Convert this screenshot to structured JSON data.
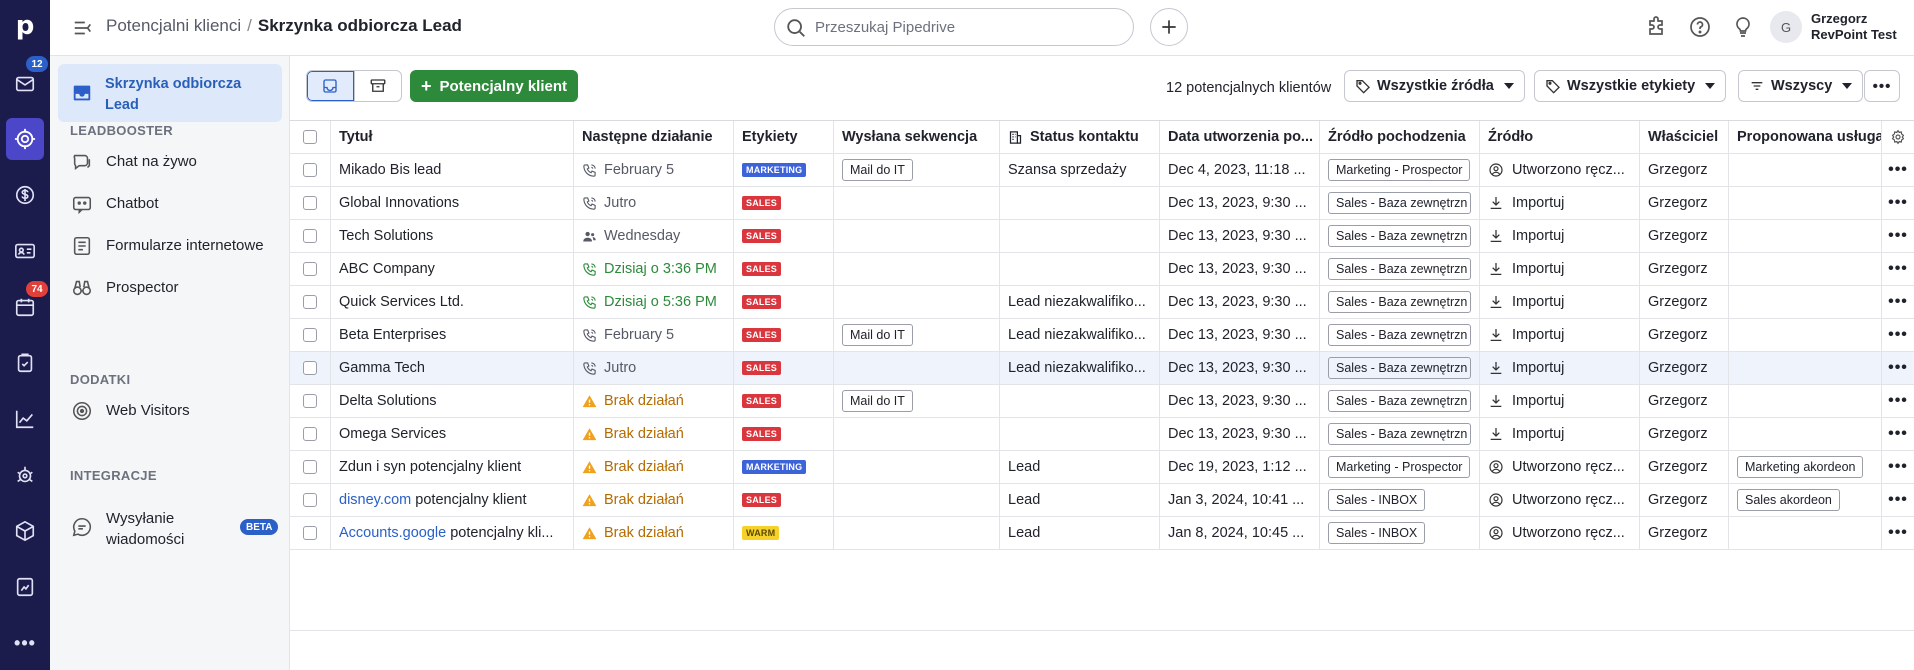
{
  "rail": {
    "logo": "p",
    "badges": {
      "mail": "12",
      "calendar": "74"
    },
    "badge_colors": {
      "mail": "#2a60c8",
      "calendar": "#e0403a"
    },
    "items": [
      "mail-icon",
      "target-icon",
      "dollar-icon",
      "contact-card-icon",
      "calendar-icon",
      "clipboard-icon",
      "chart-icon",
      "gear-bug-icon",
      "box-icon",
      "document-icon",
      "more-icon"
    ]
  },
  "header": {
    "breadcrumb_parent": "Potencjalni klienci",
    "breadcrumb_sep": "/",
    "breadcrumb_current": "Skrzynka odbiorcza Lead",
    "search_placeholder": "Przeszukaj Pipedrive",
    "avatar_initial": "G",
    "user_name": "Grzegorz",
    "user_company": "RevPoint Test"
  },
  "side": {
    "active_item": "Skrzynka odbiorcza Lead",
    "sections": [
      {
        "title": "LEADBOOSTER",
        "items": [
          "Chat na żywo",
          "Chatbot",
          "Formularze internetowe",
          "Prospector"
        ]
      },
      {
        "title": "DODATKI",
        "items": [
          "Web Visitors"
        ]
      },
      {
        "title": "INTEGRACJE",
        "items": [
          "Wysyłanie wiadomości"
        ]
      }
    ],
    "beta_label": "BETA"
  },
  "toolbar": {
    "new_lead": "Potencjalny klient",
    "count": "12 potencjalnych klientów",
    "filter_sources": "Wszystkie źródła",
    "filter_labels": "Wszystkie etykiety",
    "filter_owner": "Wszyscy",
    "more": "•••"
  },
  "columns": [
    "Tytuł",
    "Następne działanie",
    "Etykiety",
    "Wysłana sekwencja",
    "Status kontaktu",
    "Data utworzenia po...",
    "Źródło pochodzenia",
    "Źródło",
    "Właściciel",
    "Proponowana usługa"
  ],
  "tag_colors": {
    "MARKETING": "#3d63d8",
    "SALES": "#d9363e",
    "WARM": "#f5d12a"
  },
  "action_colors": {
    "normal": "#555a66",
    "today": "#2d8a3b",
    "none": "#b36b00"
  },
  "rows": [
    {
      "link": "",
      "title": "Mikado Bis lead",
      "action_icon": "phone",
      "action": "February 5",
      "action_type": "normal",
      "tag": "MARKETING",
      "sequence": "Mail do IT",
      "status": "Szansa sprzedaży",
      "created": "Dec 4, 2023, 11:18 ...",
      "origin": "Marketing - Prospector",
      "source_icon": "user",
      "source": "Utworzono ręcz...",
      "owner": "Grzegorz",
      "service": ""
    },
    {
      "link": "",
      "title": "Global Innovations",
      "action_icon": "phone",
      "action": "Jutro",
      "action_type": "normal",
      "tag": "SALES",
      "sequence": "",
      "status": "",
      "created": "Dec 13, 2023, 9:30 ...",
      "origin": "Sales - Baza zewnętrzn",
      "source_icon": "import",
      "source": "Importuj",
      "owner": "Grzegorz",
      "service": ""
    },
    {
      "link": "",
      "title": "Tech Solutions",
      "action_icon": "people",
      "action": "Wednesday",
      "action_type": "normal",
      "tag": "SALES",
      "sequence": "",
      "status": "",
      "created": "Dec 13, 2023, 9:30 ...",
      "origin": "Sales - Baza zewnętrzn",
      "source_icon": "import",
      "source": "Importuj",
      "owner": "Grzegorz",
      "service": ""
    },
    {
      "link": "",
      "title": "ABC Company",
      "action_icon": "phone",
      "action": "Dzisiaj o 3:36 PM",
      "action_type": "today",
      "tag": "SALES",
      "sequence": "",
      "status": "",
      "created": "Dec 13, 2023, 9:30 ...",
      "origin": "Sales - Baza zewnętrzn",
      "source_icon": "import",
      "source": "Importuj",
      "owner": "Grzegorz",
      "service": ""
    },
    {
      "link": "",
      "title": "Quick Services Ltd.",
      "action_icon": "phone",
      "action": "Dzisiaj o 5:36 PM",
      "action_type": "today",
      "tag": "SALES",
      "sequence": "",
      "status": "Lead niezakwalifiko...",
      "created": "Dec 13, 2023, 9:30 ...",
      "origin": "Sales - Baza zewnętrzn",
      "source_icon": "import",
      "source": "Importuj",
      "owner": "Grzegorz",
      "service": ""
    },
    {
      "link": "",
      "title": "Beta Enterprises",
      "action_icon": "phone",
      "action": "February 5",
      "action_type": "normal",
      "tag": "SALES",
      "sequence": "Mail do IT",
      "status": "Lead niezakwalifiko...",
      "created": "Dec 13, 2023, 9:30 ...",
      "origin": "Sales - Baza zewnętrzn",
      "source_icon": "import",
      "source": "Importuj",
      "owner": "Grzegorz",
      "service": ""
    },
    {
      "link": "",
      "title": "Gamma Tech",
      "action_icon": "phone",
      "action": "Jutro",
      "action_type": "normal",
      "tag": "SALES",
      "sequence": "",
      "status": "Lead niezakwalifiko...",
      "created": "Dec 13, 2023, 9:30 ...",
      "origin": "Sales - Baza zewnętrzn",
      "source_icon": "import",
      "source": "Importuj",
      "owner": "Grzegorz",
      "service": "",
      "highlight": true
    },
    {
      "link": "",
      "title": "Delta Solutions",
      "action_icon": "warning",
      "action": "Brak działań",
      "action_type": "none",
      "tag": "SALES",
      "sequence": "Mail do IT",
      "status": "",
      "created": "Dec 13, 2023, 9:30 ...",
      "origin": "Sales - Baza zewnętrzn",
      "source_icon": "import",
      "source": "Importuj",
      "owner": "Grzegorz",
      "service": ""
    },
    {
      "link": "",
      "title": "Omega Services",
      "action_icon": "warning",
      "action": "Brak działań",
      "action_type": "none",
      "tag": "SALES",
      "sequence": "",
      "status": "",
      "created": "Dec 13, 2023, 9:30 ...",
      "origin": "Sales - Baza zewnętrzn",
      "source_icon": "import",
      "source": "Importuj",
      "owner": "Grzegorz",
      "service": ""
    },
    {
      "link": "",
      "title": "Zdun i syn potencjalny klient",
      "action_icon": "warning",
      "action": "Brak działań",
      "action_type": "none",
      "tag": "MARKETING",
      "sequence": "",
      "status": "Lead",
      "created": "Dec 19, 2023, 1:12 ...",
      "origin": "Marketing - Prospector",
      "source_icon": "user",
      "source": "Utworzono ręcz...",
      "owner": "Grzegorz",
      "service": "Marketing akordeon"
    },
    {
      "link": "disney.com",
      "title": " potencjalny klient",
      "action_icon": "warning",
      "action": "Brak działań",
      "action_type": "none",
      "tag": "SALES",
      "sequence": "",
      "status": "Lead",
      "created": "Jan 3, 2024, 10:41 ...",
      "origin": "Sales - INBOX",
      "source_icon": "user",
      "source": "Utworzono ręcz...",
      "owner": "Grzegorz",
      "service": "Sales akordeon"
    },
    {
      "link": "Accounts.google",
      "title": " potencjalny kli...",
      "action_icon": "warning",
      "action": "Brak działań",
      "action_type": "none",
      "tag": "WARM",
      "sequence": "",
      "status": "Lead",
      "created": "Jan 8, 2024, 10:45 ...",
      "origin": "Sales - INBOX",
      "source_icon": "user",
      "source": "Utworzono ręcz...",
      "owner": "Grzegorz",
      "service": ""
    }
  ]
}
